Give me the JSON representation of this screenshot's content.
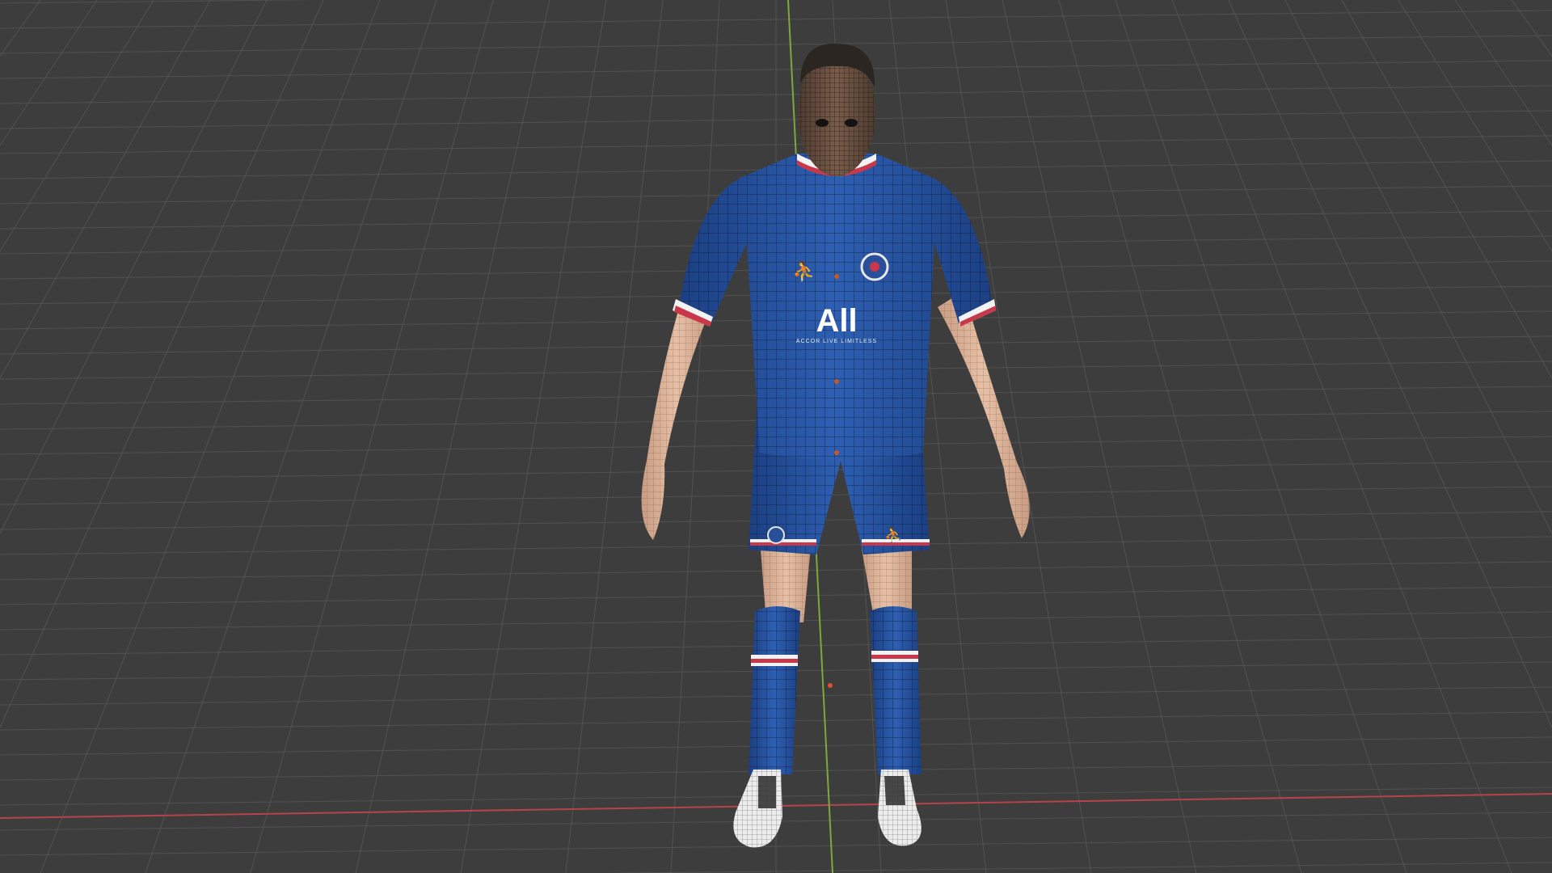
{
  "scene": {
    "type": "3d-viewport",
    "background_color": "#3d3d3d",
    "grid_color": "#525252",
    "axis_x_color": "#b5434a",
    "axis_y_color": "#7ea83c",
    "object": "football player model in wireframe-overlay view"
  },
  "model": {
    "kit_primary_color": "#244f9e",
    "kit_trim_red": "#c9384a",
    "kit_trim_white": "#f2f2f2",
    "skin_color": "#e0b79d",
    "hair_color": "#2b2622",
    "boot_color": "#eeeeee",
    "shirt_sponsor": "All",
    "shirt_sponsor_tagline": "ACCOR LIVE LIMITLESS"
  }
}
